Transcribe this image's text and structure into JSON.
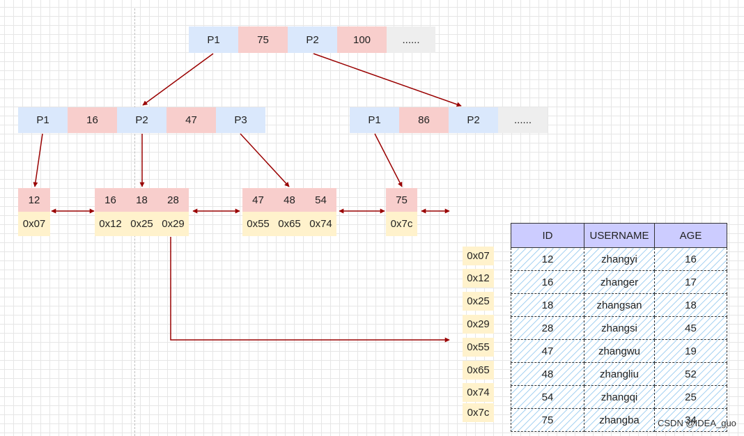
{
  "root_node": {
    "p1": "P1",
    "key1": "75",
    "p2": "P2",
    "key2": "100",
    "more": "......"
  },
  "internal_left": {
    "p1": "P1",
    "key1": "16",
    "p2": "P2",
    "key2": "47",
    "p3": "P3"
  },
  "internal_right": {
    "p1": "P1",
    "key1": "86",
    "p2": "P2",
    "more": "......"
  },
  "leaves": [
    {
      "keys": [
        "12"
      ],
      "addrs": [
        "0x07"
      ]
    },
    {
      "keys": [
        "16",
        "18",
        "28"
      ],
      "addrs": [
        "0x12",
        "0x25",
        "0x29"
      ]
    },
    {
      "keys": [
        "47",
        "48",
        "54"
      ],
      "addrs": [
        "0x55",
        "0x65",
        "0x74"
      ]
    },
    {
      "keys": [
        "75"
      ],
      "addrs": [
        "0x7c"
      ]
    }
  ],
  "row_addresses": [
    "0x07",
    "0x12",
    "0x25",
    "0x29",
    "0x55",
    "0x65",
    "0x74",
    "0x7c"
  ],
  "table": {
    "headers": [
      "ID",
      "USERNAME",
      "AGE"
    ],
    "rows": [
      [
        "12",
        "zhangyi",
        "16"
      ],
      [
        "16",
        "zhanger",
        "17"
      ],
      [
        "18",
        "zhangsan",
        "18"
      ],
      [
        "28",
        "zhangsi",
        "45"
      ],
      [
        "47",
        "zhangwu",
        "19"
      ],
      [
        "48",
        "zhangliu",
        "52"
      ],
      [
        "54",
        "zhangqi",
        "25"
      ],
      [
        "75",
        "zhangba",
        "34"
      ]
    ]
  },
  "watermark": "CSDN @IDEA_guo",
  "colors": {
    "pointer": "#dae8fc",
    "key": "#f8cecc",
    "address": "#fff2cc",
    "more": "#eeeeee",
    "header": "#ccccff",
    "arrow": "#990000"
  }
}
